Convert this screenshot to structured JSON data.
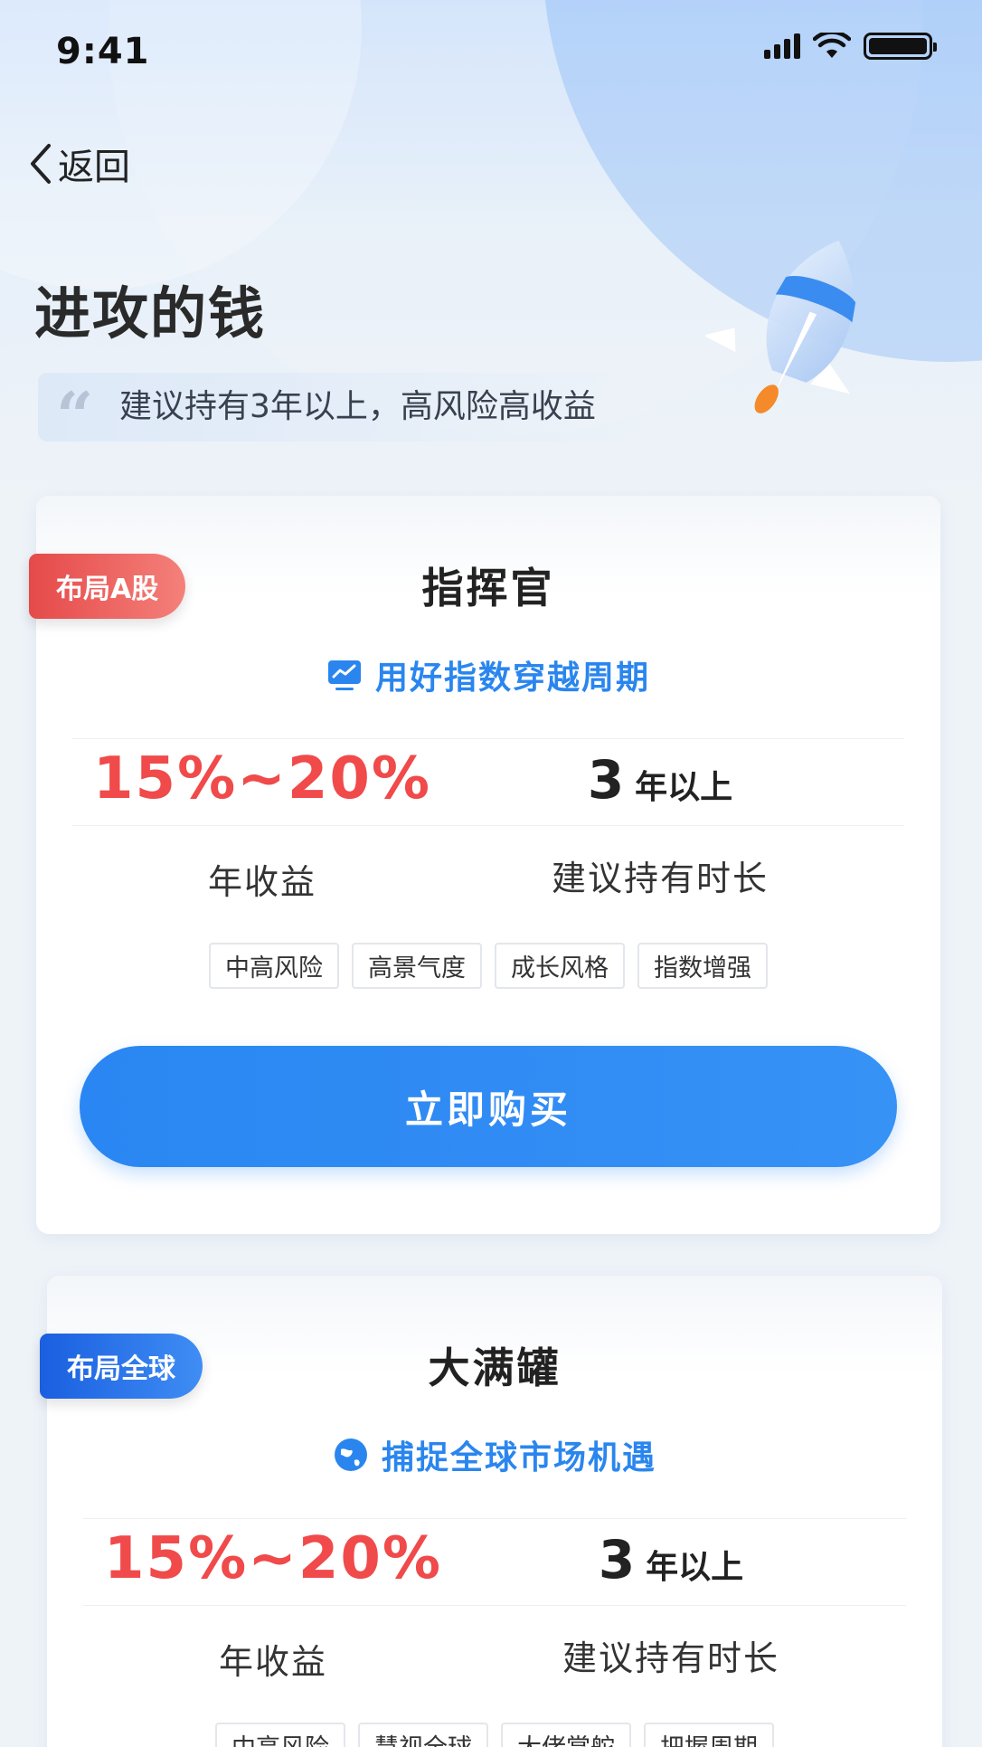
{
  "status_bar": {
    "time": "9:41"
  },
  "nav": {
    "back_label": "返回"
  },
  "header": {
    "title": "进攻的钱",
    "quote_mark": "“",
    "subtitle": "建议持有3年以上，高风险高收益"
  },
  "cards": [
    {
      "tag": "布局A股",
      "tag_color": "#e54a4a",
      "name": "指挥官",
      "slogan": "用好指数穿越周期",
      "slogan_icon": "chart-monitor-icon",
      "yield": "15%~20%",
      "yield_label": "年收益",
      "hold_number": "3",
      "hold_unit": "年以上",
      "hold_label": "建议持有时长",
      "chips": [
        "中高风险",
        "高景气度",
        "成长风格",
        "指数增强"
      ],
      "button_label": "立即购买"
    },
    {
      "tag": "布局全球",
      "tag_color": "#1a5fe0",
      "name": "大满罐",
      "slogan": "捕捉全球市场机遇",
      "slogan_icon": "globe-icon",
      "yield": "15%~20%",
      "yield_label": "年收益",
      "hold_number": "3",
      "hold_unit": "年以上",
      "hold_label": "建议持有时长",
      "chips": [
        "中高风险",
        "慧视全球",
        "大佬掌舵",
        "把握周期"
      ]
    }
  ],
  "colors": {
    "accent_blue": "#2a86f2",
    "yield_red": "#f04a4a"
  }
}
